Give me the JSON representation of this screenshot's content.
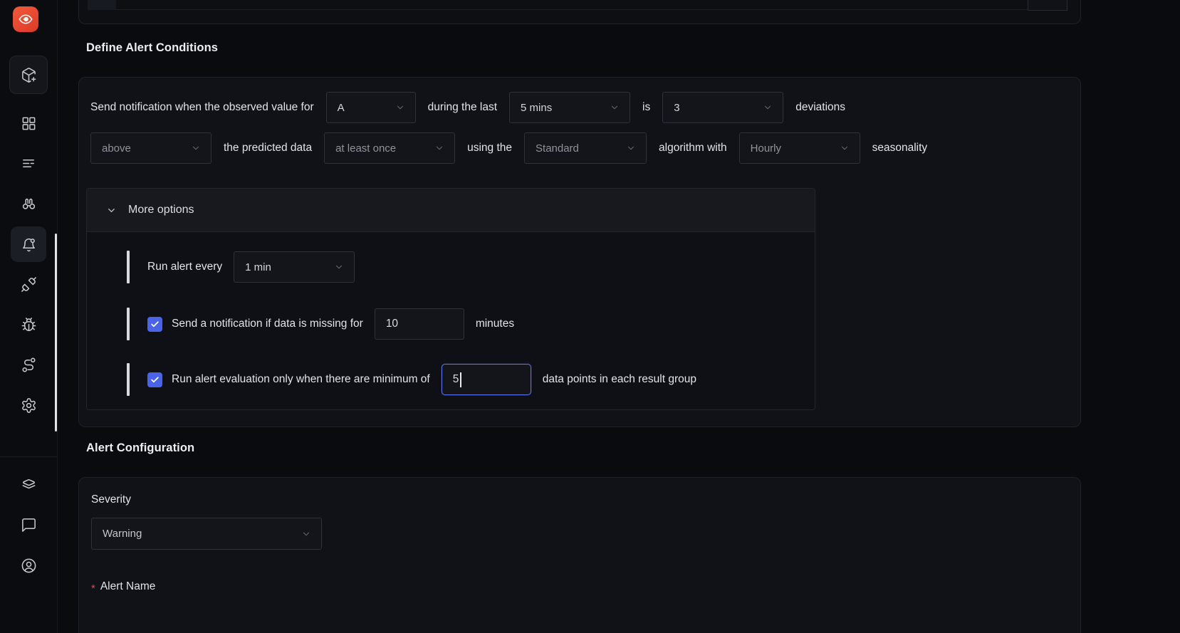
{
  "headings": {
    "define_alert_conditions": "Define Alert Conditions",
    "alert_configuration": "Alert Configuration"
  },
  "condition_row1": {
    "prefix": "Send notification when the observed value for",
    "query_value": "A",
    "during_label": "during the last",
    "window_value": "5 mins",
    "is_label": "is",
    "deviation_value": "3",
    "suffix": "deviations"
  },
  "condition_row2": {
    "op_value": "above",
    "predicted_label": "the predicted data",
    "match_value": "at least once",
    "using_label": "using the",
    "algorithm_value": "Standard",
    "algorithm_label": "algorithm with",
    "seasonality_value": "Hourly",
    "suffix": "seasonality"
  },
  "more_options": {
    "title": "More options",
    "run_alert_every_label": "Run alert every",
    "frequency_value": "1 min",
    "missing_data": {
      "checked": true,
      "label": "Send a notification if data is missing for",
      "value": "10",
      "suffix": "minutes"
    },
    "min_points": {
      "checked": true,
      "label": "Run alert evaluation only when there are minimum of",
      "value": "5",
      "suffix": "data points in each result group"
    }
  },
  "alert_config": {
    "severity_label": "Severity",
    "severity_value": "Warning",
    "required_marker": "*",
    "alert_name_label": "Alert Name"
  },
  "sidebar": {
    "icons": [
      "signoz-logo",
      "get-started",
      "dashboards",
      "logs",
      "explorer",
      "alerts",
      "integrations",
      "exceptions",
      "service-map",
      "settings",
      "layers",
      "support-chat",
      "account"
    ],
    "active_item": "alerts"
  },
  "colors": {
    "brand_orange": "#e8503a",
    "checkbox_blue": "#4a63e8",
    "focus_border": "#5b76ee",
    "required_red": "#e5484d"
  }
}
